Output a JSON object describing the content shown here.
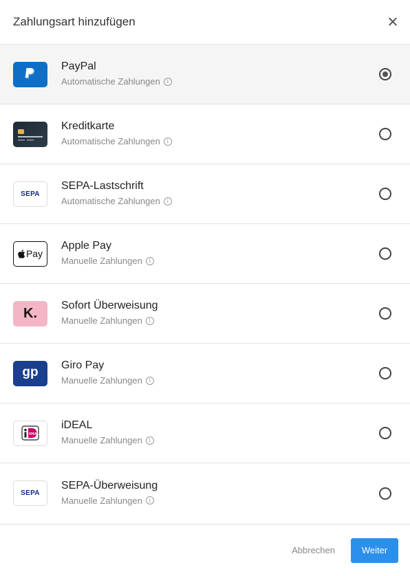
{
  "dialog": {
    "title": "Zahlungsart hinzufügen"
  },
  "methods": [
    {
      "name": "PayPal",
      "subtitle": "Automatische Zahlungen",
      "selected": true,
      "icon": "paypal-logo"
    },
    {
      "name": "Kreditkarte",
      "subtitle": "Automatische Zahlungen",
      "selected": false,
      "icon": "credit-card-logo"
    },
    {
      "name": "SEPA-Lastschrift",
      "subtitle": "Automatische Zahlungen",
      "selected": false,
      "icon": "sepa-logo"
    },
    {
      "name": "Apple Pay",
      "subtitle": "Manuelle Zahlungen",
      "selected": false,
      "icon": "apple-pay-logo"
    },
    {
      "name": "Sofort Überweisung",
      "subtitle": "Manuelle Zahlungen",
      "selected": false,
      "icon": "klarna-logo"
    },
    {
      "name": "Giro Pay",
      "subtitle": "Manuelle Zahlungen",
      "selected": false,
      "icon": "giropay-logo"
    },
    {
      "name": "iDEAL",
      "subtitle": "Manuelle Zahlungen",
      "selected": false,
      "icon": "ideal-logo"
    },
    {
      "name": "SEPA-Überweisung",
      "subtitle": "Manuelle Zahlungen",
      "selected": false,
      "icon": "sepa-logo"
    }
  ],
  "logos": {
    "sepa_text": "SEPA",
    "apple_pay_text": "Pay",
    "klarna_text": "K.",
    "giro_text": "gp",
    "ideal_text": "iDEAL"
  },
  "footer": {
    "cancel_label": "Abbrechen",
    "next_label": "Weiter"
  },
  "colors": {
    "accent": "#2b8fec",
    "paypal": "#0f6fc6",
    "klarna": "#f4b6c7",
    "giropay": "#1a3f8f"
  }
}
